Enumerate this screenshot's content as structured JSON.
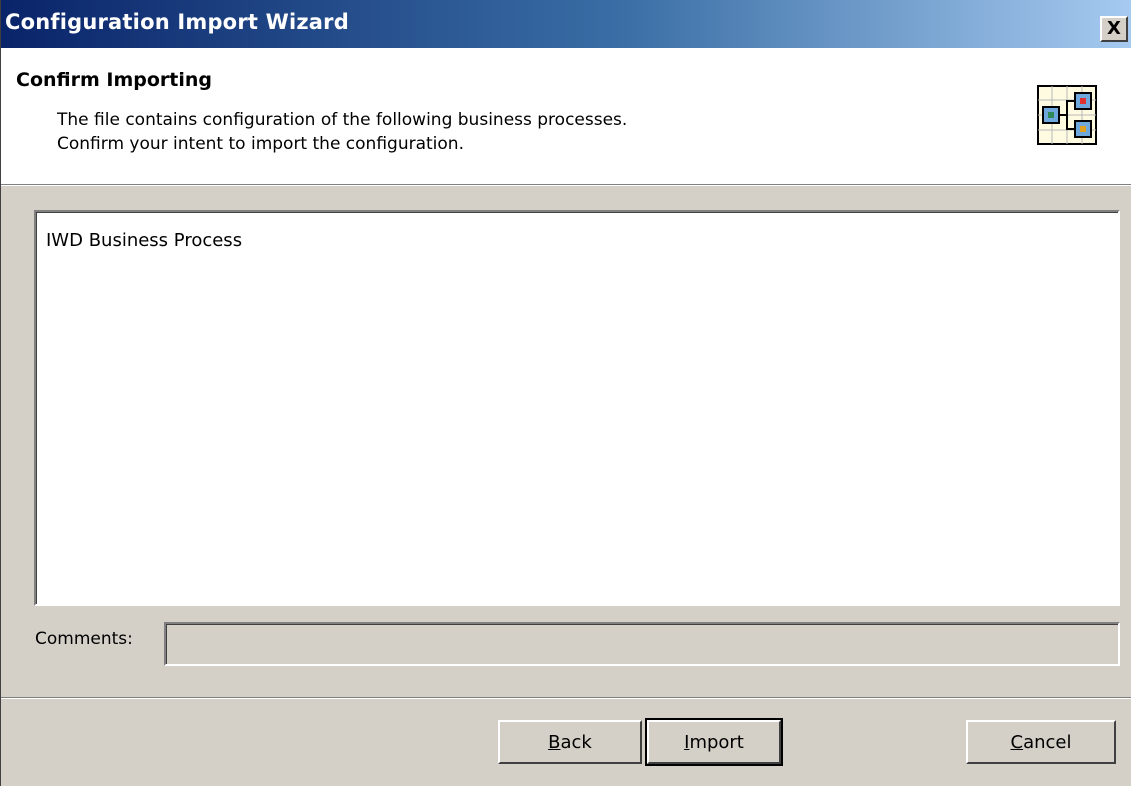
{
  "window": {
    "title": "Configuration Import Wizard",
    "close_label": "X"
  },
  "header": {
    "title": "Confirm Importing",
    "description_line1": "The file contains configuration of the following business processes.",
    "description_line2": "Confirm your intent to import the configuration.",
    "icon": "business-process-icon"
  },
  "processes": {
    "items": [
      "IWD Business Process"
    ]
  },
  "comments": {
    "label": "Comments:",
    "value": ""
  },
  "buttons": {
    "back": {
      "access_key": "B",
      "rest": "ack"
    },
    "import": {
      "access_key": "I",
      "rest": "mport",
      "is_default": true
    },
    "cancel": {
      "access_key": "C",
      "rest": "ancel"
    }
  },
  "colors": {
    "titlebar_start": "#0a246a",
    "titlebar_end": "#a6caf0",
    "dialog_bg": "#d4d0c8"
  }
}
